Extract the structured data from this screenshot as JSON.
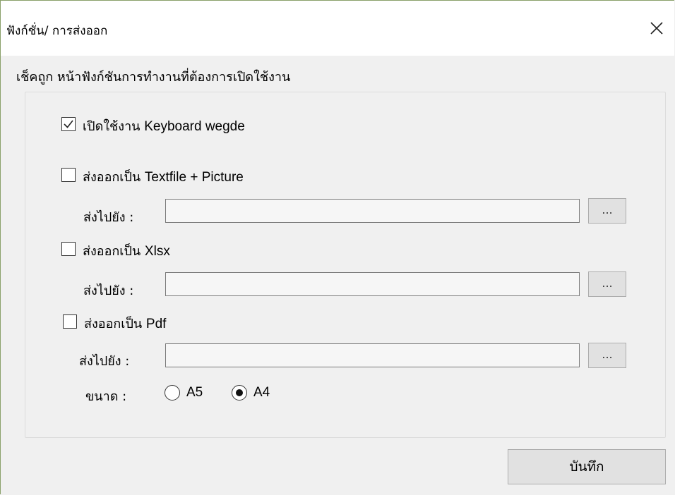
{
  "window": {
    "title": "ฟังก์ชั่น/ การส่งออก",
    "close_icon": "close-icon"
  },
  "instruction": "เช็คถูก หน้าฟังก์ชันการทำงานที่ต้องการเปิดใช้งาน",
  "options": {
    "keyboard_wedge": {
      "label_th": "เปิดใช้งาน",
      "label_en": "Keyboard wegde",
      "checked": true
    },
    "textfile_picture": {
      "label_th": "ส่งออกเป็น",
      "label_en": "Textfile + Picture",
      "checked": false,
      "dest_label": "ส่งไปยัง :",
      "dest_value": "",
      "browse_label": "..."
    },
    "xlsx": {
      "label_th": "ส่งออกเป็น",
      "label_en": "Xlsx",
      "checked": false,
      "dest_label": "ส่งไปยัง :",
      "dest_value": "",
      "browse_label": "..."
    },
    "pdf": {
      "label_th": "ส่งออกเป็น",
      "label_en": "Pdf",
      "checked": false,
      "dest_label": "ส่งไปยัง :",
      "dest_value": "",
      "browse_label": "...",
      "size_label": "ขนาด :",
      "sizes": [
        {
          "label": "A5",
          "selected": false
        },
        {
          "label": "A4",
          "selected": true
        }
      ]
    }
  },
  "save_label": "บันทึก"
}
